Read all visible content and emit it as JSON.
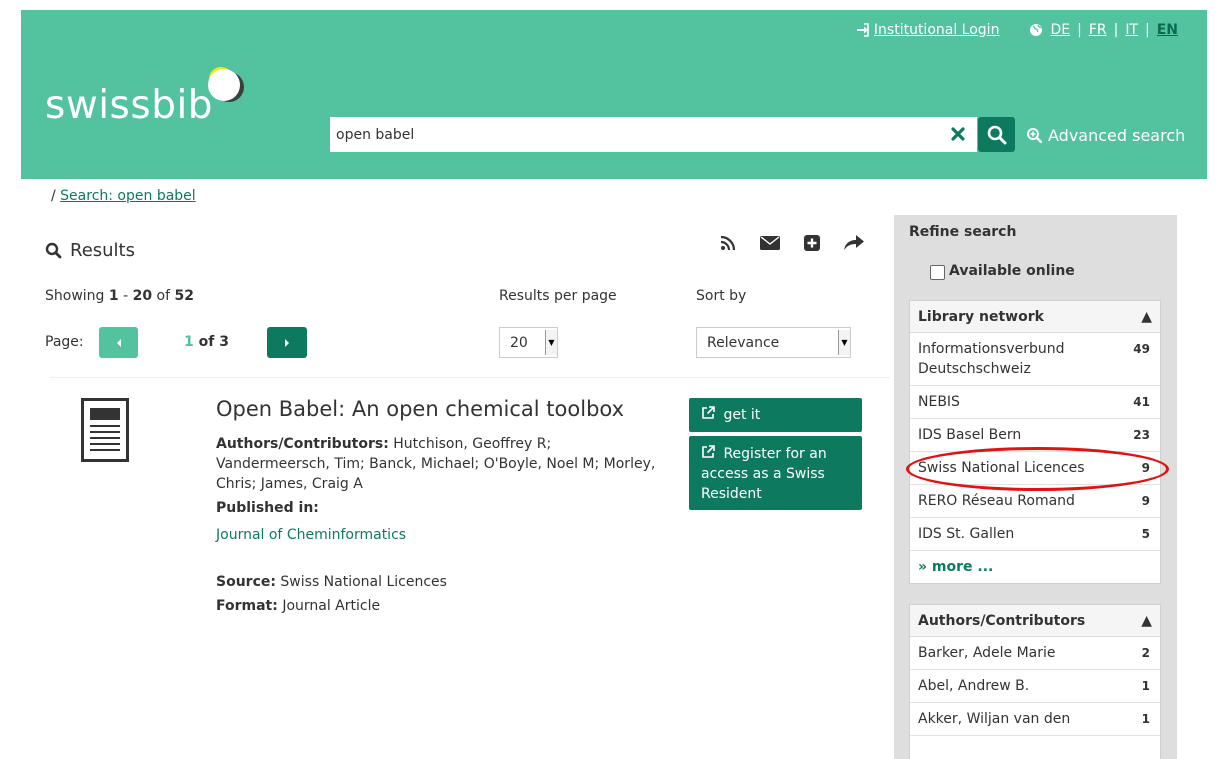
{
  "header": {
    "logo": "swissbib",
    "login_label": "Institutional Login",
    "languages": [
      "DE",
      "FR",
      "IT",
      "EN"
    ],
    "active_language": "EN",
    "search": {
      "value": "open babel",
      "placeholder": ""
    },
    "advanced_search_label": "Advanced search",
    "colors": {
      "header_bg": "#52c29f",
      "brand_dark": "#0d7a5f"
    }
  },
  "breadcrumb": {
    "separator": "/",
    "link": "Search: open babel"
  },
  "results": {
    "title": "Results",
    "showing": {
      "prefix": "Showing",
      "from": "1",
      "dash": "-",
      "to": "20",
      "of": "of",
      "total": "52"
    },
    "results_per_page_label": "Results per page",
    "results_per_page_value": "20",
    "sort_label": "Sort by",
    "sort_value": "Relevance",
    "page_label": "Page:",
    "page_current": "1",
    "page_of": "of 3"
  },
  "result": {
    "title": "Open Babel: An open chemical toolbox",
    "authors_label": "Authors/Contributors:",
    "authors": "Hutchison, Geoffrey R; Vandermeersch, Tim; Banck, Michael; O'Boyle, Noel M; Morley, Chris; James, Craig A",
    "published_label": "Published in:",
    "journal": "Journal of Cheminformatics",
    "source_label": "Source:",
    "source": "Swiss National Licences",
    "format_label": "Format:",
    "format": "Journal Article",
    "get_it_label": "get it",
    "register_label": "Register for an access as a Swiss Resident"
  },
  "sidebar": {
    "refine_title": "Refine search",
    "available_online_label": "Available online",
    "library_network": {
      "title": "Library network",
      "items": [
        {
          "label": "Informationsverbund Deutschschweiz",
          "count": "49"
        },
        {
          "label": "NEBIS",
          "count": "41"
        },
        {
          "label": "IDS Basel Bern",
          "count": "23"
        },
        {
          "label": "Swiss National Licences",
          "count": "9"
        },
        {
          "label": "RERO Réseau Romand",
          "count": "9"
        },
        {
          "label": "IDS St. Gallen",
          "count": "5"
        }
      ],
      "more_label": "» more ..."
    },
    "authors": {
      "title": "Authors/Contributors",
      "items": [
        {
          "label": "Barker, Adele Marie",
          "count": "2"
        },
        {
          "label": "Abel, Andrew B.",
          "count": "1"
        },
        {
          "label": "Akker, Wiljan van den",
          "count": "1"
        }
      ]
    }
  }
}
